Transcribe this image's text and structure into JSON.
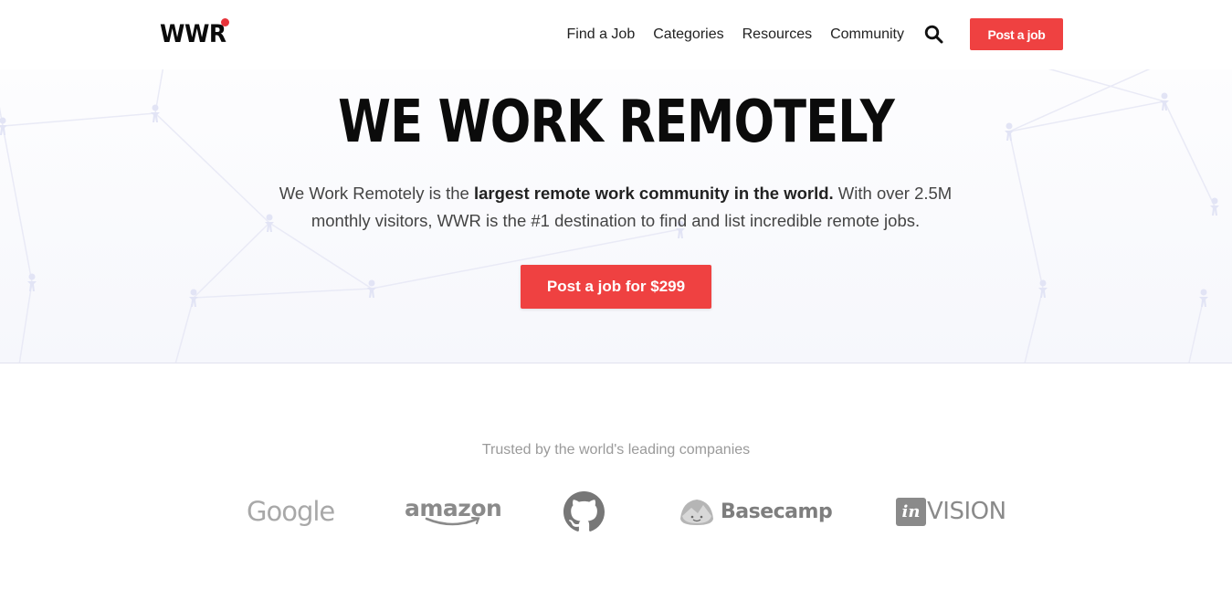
{
  "header": {
    "logo_text": "WWR",
    "nav": [
      {
        "label": "Find a Job"
      },
      {
        "label": "Categories"
      },
      {
        "label": "Resources"
      },
      {
        "label": "Community"
      }
    ],
    "search_icon": "search-icon",
    "post_job_label": "Post a job"
  },
  "hero": {
    "title": "WE WORK REMOTELY",
    "desc_prefix": "We Work Remotely is the ",
    "desc_bold": "largest remote work community in the world.",
    "desc_suffix": " With over 2.5M monthly visitors, WWR is the #1 destination to find and list incredible remote jobs.",
    "cta_label": "Post a job for $299"
  },
  "trusted": {
    "title": "Trusted by the world's leading companies",
    "logos": [
      {
        "name": "Google",
        "text": "Google"
      },
      {
        "name": "Amazon",
        "text": "amazon"
      },
      {
        "name": "GitHub",
        "icon": "github-icon"
      },
      {
        "name": "Basecamp",
        "text": "Basecamp"
      },
      {
        "name": "InVision",
        "box_text": "in",
        "text": "VISION"
      }
    ]
  },
  "colors": {
    "accent": "#ef4141",
    "logo_dot": "#e7333a",
    "hero_bg": "#f6f7fc",
    "logo_gray": "#8a8a8a"
  }
}
